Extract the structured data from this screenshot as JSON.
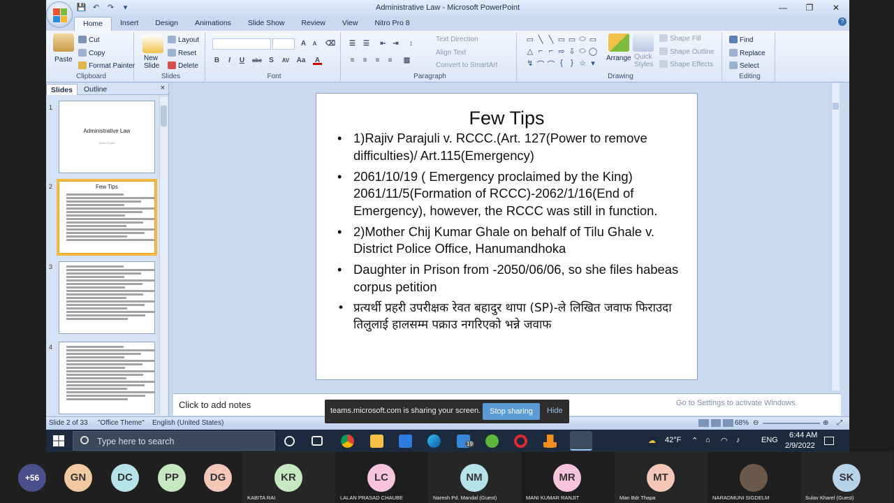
{
  "window": {
    "title": "Administrative Law - Microsoft PowerPoint",
    "controls": [
      "—",
      "❐",
      "✕"
    ]
  },
  "qat": [
    "💾",
    "↶",
    "↷",
    "▾"
  ],
  "ribbon_tabs": [
    "Home",
    "Insert",
    "Design",
    "Animations",
    "Slide Show",
    "Review",
    "View",
    "Nitro Pro 8"
  ],
  "clipboard": {
    "paste": "Paste",
    "cut": "Cut",
    "copy": "Copy",
    "format_painter": "Format Painter",
    "label": "Clipboard"
  },
  "slides_group": {
    "new_slide": "New\nSlide",
    "layout": "Layout",
    "reset": "Reset",
    "delete": "Delete",
    "label": "Slides"
  },
  "font_group": {
    "label": "Font",
    "buttons": [
      "B",
      "I",
      "U",
      "abc",
      "S",
      "AV",
      "Aa",
      "A"
    ]
  },
  "paragraph_group": {
    "label": "Paragraph",
    "text_direction": "Text Direction",
    "align_text": "Align Text",
    "convert": "Convert to SmartArt"
  },
  "drawing_group": {
    "label": "Drawing",
    "arrange": "Arrange",
    "quick_styles": "Quick\nStyles",
    "shape_fill": "Shape Fill",
    "shape_outline": "Shape Outline",
    "shape_effects": "Shape Effects",
    "shapes": [
      "▭",
      "╲",
      "╲",
      "▭",
      "▭",
      "⬭",
      "▭",
      "△",
      "⌐",
      "⌐",
      "⇨",
      "⇩",
      "⬭",
      "◯",
      "↯",
      "⌒",
      "⌒",
      "{",
      "}",
      "☆",
      "▾"
    ]
  },
  "editing_group": {
    "label": "Editing",
    "find": "Find",
    "replace": "Replace",
    "select": "Select"
  },
  "left_pane": {
    "tabs": [
      "Slides",
      "Outline"
    ],
    "close": "×",
    "thumbs": [
      {
        "num": "1",
        "title": "Administrative Law",
        "sub": "Sulav Kharel"
      },
      {
        "num": "2",
        "title": "Few Tips",
        "lines": 10
      },
      {
        "num": "3",
        "lines": 10
      },
      {
        "num": "4",
        "lines": 10
      }
    ]
  },
  "slide": {
    "title": "Few Tips",
    "bullets": [
      "1)Rajiv Parajuli v. RCCC.(Art. 127(Power to remove difficulties)/ Art.115(Emergency)",
      "2061/10/19 ( Emergency proclaimed by the King) 2061/11/5(Formation of RCCC)-2062/1/16(End of Emergency), however, the RCCC was still in function.",
      "2)Mother Chij Kumar Ghale on behalf of Tilu Ghale v. District Police Office, Hanumandhoka",
      "Daughter in Prison from -2050/06/06, so she files habeas corpus petition",
      "प्रत्यर्थी प्रहरी उपरीक्षक रेवत बहादुर थापा (SP)-ले लिखित जवाफ फिराउदा तिलुलाई हालसम्म पक्राउ नगरिएको भन्ने जवाफ"
    ]
  },
  "notes": {
    "placeholder": "Click to add notes"
  },
  "activate_windows": "Go to Settings to activate Windows.",
  "status": {
    "slide": "Slide 2 of 33",
    "theme": "\"Office Theme\"",
    "language": "English (United States)",
    "zoom": "68%"
  },
  "share_bar": {
    "message": "teams.microsoft.com is sharing your screen.",
    "stop": "Stop sharing",
    "hide": "Hide"
  },
  "taskbar": {
    "search": "Type here to search",
    "weather": "42°F",
    "lang": "ENG",
    "time": "6:44 AM",
    "date": "2/9/2022",
    "mail_badge": "19"
  },
  "participants": [
    {
      "initials": "+56",
      "name": "",
      "color": "#4b4f8c"
    },
    {
      "initials": "GN",
      "name": "",
      "color": "#f2c9a5"
    },
    {
      "initials": "DC",
      "name": "",
      "color": "#b6e3ea"
    },
    {
      "initials": "PP",
      "name": "",
      "color": "#c5e8c1"
    },
    {
      "initials": "DG",
      "name": "",
      "color": "#f4c7b8"
    },
    {
      "initials": "KR",
      "name": "KABITA RAI",
      "color": "#c5e8c1"
    },
    {
      "initials": "LC",
      "name": "LALAN PRASAD CHAUBE",
      "color": "#f6c5dc"
    },
    {
      "initials": "NM",
      "name": "Naresh Pd. Mandal (Guest)",
      "color": "#b6e3ea"
    },
    {
      "initials": "MR",
      "name": "MANI KUMAR RANJIT",
      "color": "#f6c5dc"
    },
    {
      "initials": "MT",
      "name": "Man Bdr Thapa",
      "color": "#f4c7b8"
    },
    {
      "initials": "",
      "name": "NARADMUNI SIGDELM",
      "color": "#6b5a4a"
    },
    {
      "initials": "SK",
      "name": "Sulav Kharel (Guest)",
      "color": "#b6d3ea"
    }
  ],
  "colors": {
    "accent": "#5b9bd5",
    "ribbon": "#dbe7f7",
    "selection": "#f4b942"
  }
}
